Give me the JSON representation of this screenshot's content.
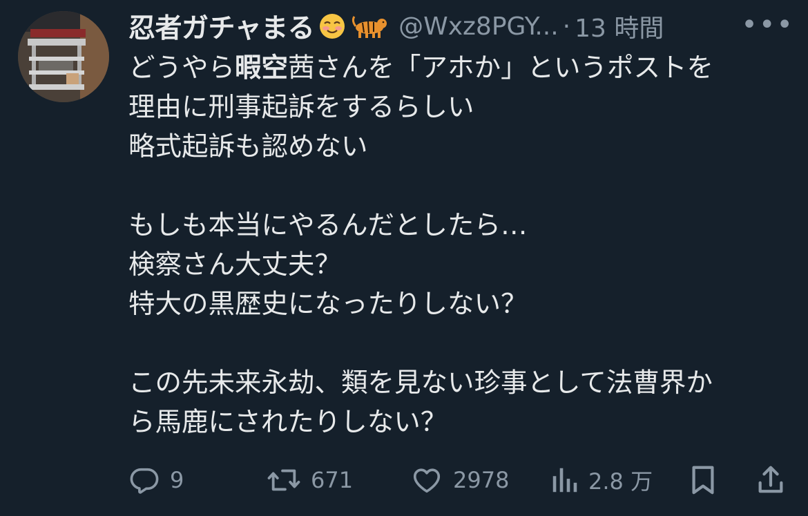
{
  "author": {
    "display_name": "忍者ガチャまる",
    "emojis": [
      "smiling-face-emoji",
      "tiger-emoji"
    ],
    "handle": "@Wxz8PGY...",
    "separator": "·",
    "timestamp": "13 時間",
    "more_label": "•••"
  },
  "post": {
    "line1_pre": "どうやら",
    "line1_bold": "暇空",
    "line1_post": "茜さんを「アホか」というポストを",
    "line2": "理由に刑事起訴をするらしい",
    "line3": "略式起訴も認めない",
    "line4": "もしも本当にやるんだとしたら…",
    "line5": "検察さん大丈夫？",
    "line6": "特大の黒歴史になったりしない？",
    "line7": "この先未来永劫、類を見ない珍事として法曹界か",
    "line8": "ら馬鹿にされたりしない？"
  },
  "actions": {
    "replies": "9",
    "reposts": "671",
    "likes": "2978",
    "views": "2.8 万"
  },
  "colors": {
    "background": "#15202b",
    "text": "#e7e9ea",
    "secondary": "#8b98a5"
  }
}
